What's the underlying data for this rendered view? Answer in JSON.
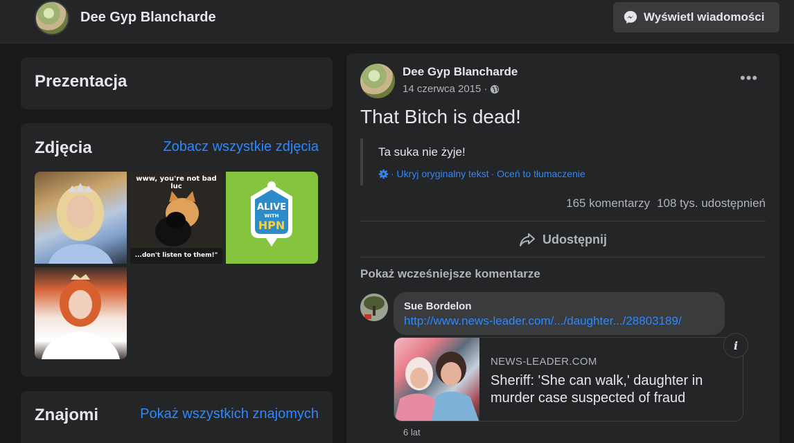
{
  "header": {
    "profile_name": "Dee Gyp Blancharde",
    "message_button": "Wyświetl wiadomości"
  },
  "intro": {
    "title": "Prezentacja"
  },
  "photos": {
    "title": "Zdjęcia",
    "see_all": "Zobacz wszystkie zdjęcia",
    "kitten_top_text": "www, you're not bad luc",
    "kitten_bottom_text": "...don't listen to them!\"",
    "logo_alive": "ALIVE",
    "logo_with": "WITH",
    "logo_hpn": "HPN"
  },
  "friends": {
    "title": "Znajomi",
    "see_all": "Pokaż wszystkich znajomych"
  },
  "post": {
    "author": "Dee Gyp Blancharde",
    "date": "14 czerwca 2015",
    "separator": "·",
    "text": "That Bitch is dead!",
    "translation": "Ta suka nie żyje!",
    "hide_original": "· Ukryj oryginalny tekst",
    "rate_translation": "· Oceń to tłumaczenie",
    "comments_count": "165 komentarzy",
    "shares_count": "108 tys. udostępnień",
    "share_label": "Udostępnij",
    "more_comments": "Pokaż wcześniejsze komentarze"
  },
  "comment": {
    "author": "Sue Bordelon",
    "link": "http://www.news-leader.com/.../daughter.../28803189/",
    "preview_source": "NEWS-LEADER.COM",
    "preview_title": "Sheriff: 'She can walk,' daughter in murder case suspected of fraud",
    "time": "6 lat"
  },
  "colors": {
    "background": "#18191a",
    "card": "#242526",
    "link": "#2d88ff",
    "secondary_text": "#b0b3b8"
  }
}
